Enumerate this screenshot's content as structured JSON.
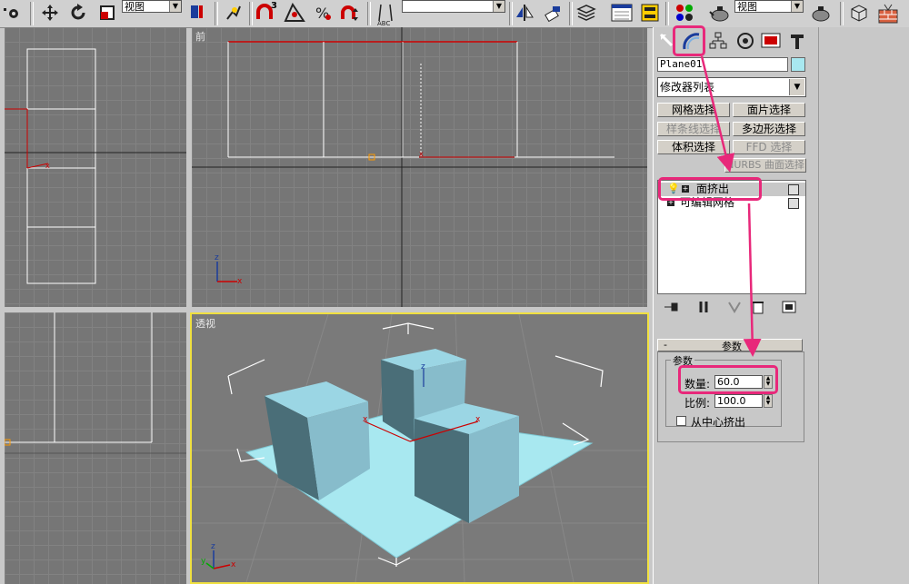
{
  "toolbar": {
    "view_combo_1": "视图",
    "view_combo_2": "视图",
    "snap_angle_label": "3",
    "named_selection_value": ""
  },
  "viewports": {
    "front_label": "前",
    "perspective_label": "透视",
    "axis_x": "x",
    "axis_y": "y",
    "axis_z": "z"
  },
  "panel": {
    "object_name": "Plane01",
    "object_color": "#a8e8f0",
    "modifier_list": "修改器列表",
    "buttons": {
      "mesh_select": "网格选择",
      "patch_select": "面片选择",
      "spline_select": "样条线选择",
      "poly_select": "多边形选择",
      "vol_select": "体积选择",
      "ffd_select": "FFD 选择",
      "nurbs_select": "NURBS 曲面选择"
    },
    "stack": [
      "面挤出",
      "可编辑网格"
    ],
    "rollout_minus": "-",
    "rollout_title": "参数",
    "group_title": "参数",
    "amount_label": "数量:",
    "amount_value": "60.0",
    "scale_label": "比例:",
    "scale_value": "100.0",
    "center_label": "从中心挤出"
  },
  "colors": {
    "highlight": "#e8287a",
    "viewport_bg": "#767676",
    "box_fill": "#a8e8f0"
  }
}
